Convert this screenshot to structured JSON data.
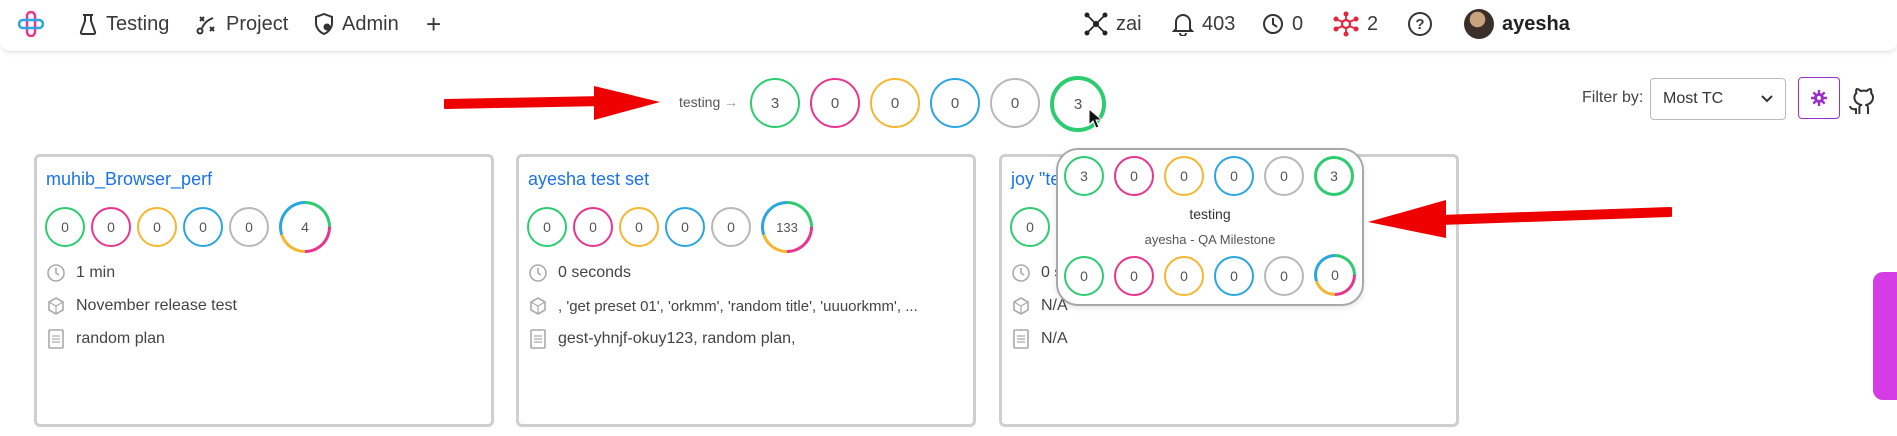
{
  "nav": {
    "testing": "Testing",
    "project": "Project",
    "admin": "Admin",
    "add": "+",
    "workspace": "zai",
    "notifications": "403",
    "pending": "0",
    "network": "2",
    "help": "?",
    "user": "ayesha"
  },
  "header_row": {
    "label": "testing",
    "arrow": "→",
    "counts": [
      "3",
      "0",
      "0",
      "0",
      "0",
      "3"
    ]
  },
  "filter": {
    "label": "Filter by:",
    "selected": "Most TC"
  },
  "cards": [
    {
      "title": "muhib_Browser_perf",
      "counts": [
        "0",
        "0",
        "0",
        "0",
        "0",
        "4"
      ],
      "duration": "1 min",
      "milestone": "November release test",
      "plan": "random plan"
    },
    {
      "title": "ayesha test set",
      "counts": [
        "0",
        "0",
        "0",
        "0",
        "0",
        "133"
      ],
      "duration": "0 seconds",
      "milestone": ", 'get preset 01', 'orkmm', 'random title', 'uuuorkmm', ...",
      "plan": "gest-yhnjf-okuy123, random plan,"
    },
    {
      "title": "joy \"te",
      "counts": [
        "0"
      ],
      "duration": "0 s",
      "milestone": "N/A",
      "plan": "N/A"
    }
  ],
  "popup": {
    "top_counts": [
      "3",
      "0",
      "0",
      "0",
      "0",
      "3"
    ],
    "name": "testing",
    "subtitle": "ayesha - QA Milestone",
    "bottom_counts": [
      "0",
      "0",
      "0",
      "0",
      "0",
      "0"
    ]
  },
  "colors": {
    "passed": "#2ecc71",
    "failed": "#e8368f",
    "blocked": "#f5b731",
    "retest": "#2ba6e0",
    "untested": "#b8b8b8",
    "link": "#1a73e8",
    "accent": "#9b30c9",
    "annotation_arrow": "#ee0000"
  },
  "icons": [
    "logo-icon",
    "flask-icon",
    "project-icon",
    "shield-icon",
    "plus-icon",
    "network-icon",
    "bell-icon",
    "clock-icon",
    "hub-icon",
    "help-icon",
    "gear-icon",
    "github-icon",
    "milestone-icon",
    "document-icon"
  ]
}
